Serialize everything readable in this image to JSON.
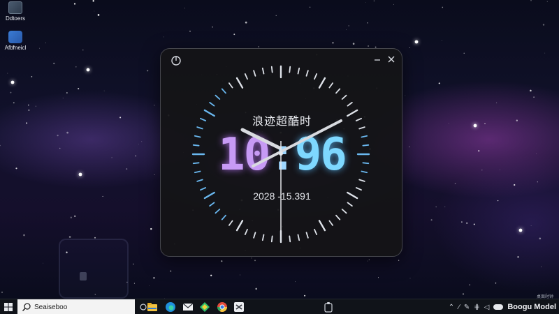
{
  "desktop": {
    "icons": [
      {
        "label": "Ddtoers",
        "icon": "app-window-icon"
      },
      {
        "label": "Afbmeicl",
        "icon": "network-app-icon"
      }
    ]
  },
  "clock_widget": {
    "title": "浪迹超酷时",
    "hours": "10",
    "separator": ":",
    "minutes": "96",
    "date": "2028 -15.391",
    "icons": {
      "power": "power-icon",
      "minimize": "minimize-icon",
      "close": "close-icon"
    },
    "colors": {
      "hours_glow": "#c79af5",
      "minutes_glow": "#7ed8ff",
      "tick": "#dfe3ea",
      "tick_accent": "#6ab8f0"
    }
  },
  "taskbar": {
    "search_placeholder": "Seaiseboo",
    "pinned_icons": [
      "task-view-icon",
      "file-explorer-icon",
      "edge-icon",
      "mail-icon",
      "store-icon",
      "chrome-icon",
      "app-icon",
      "clipboard-icon"
    ],
    "tray": {
      "label": "Boogu Model",
      "tiny_text": "桌面时钟"
    }
  }
}
